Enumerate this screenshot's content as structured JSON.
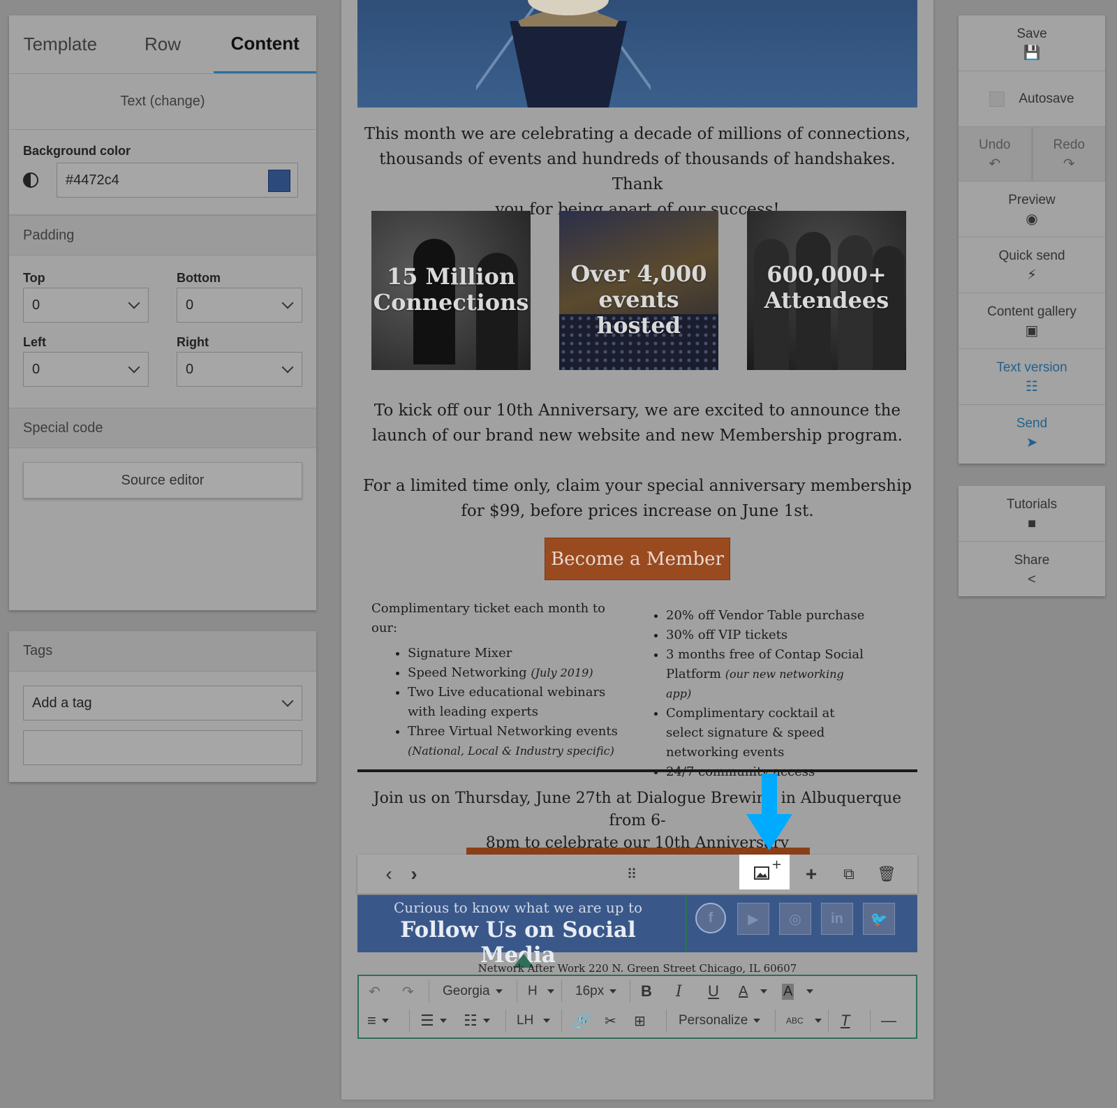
{
  "left_panel": {
    "tabs": [
      "Template",
      "Row",
      "Content"
    ],
    "active_tab": "Content",
    "text_change": "Text (change)",
    "background_color_label": "Background color",
    "background_color_value": "#4472c4",
    "padding_label": "Padding",
    "padding": {
      "top_label": "Top",
      "top_value": "0",
      "bottom_label": "Bottom",
      "bottom_value": "0",
      "left_label": "Left",
      "left_value": "0",
      "right_label": "Right",
      "right_value": "0"
    },
    "special_code_label": "Special code",
    "source_editor_label": "Source editor"
  },
  "tags_panel": {
    "title": "Tags",
    "add_tag_placeholder": "Add a tag",
    "tag_input_value": ""
  },
  "email": {
    "intro_lines": [
      "This month we are celebrating a decade of millions of connections,",
      "thousands of events and hundreds of thousands of handshakes. Thank",
      "you for being apart of our success!"
    ],
    "photos": [
      {
        "caption_lines": [
          "15 Million",
          "Connections"
        ]
      },
      {
        "caption_lines": [
          "Over 4,000",
          "events hosted"
        ]
      },
      {
        "caption_lines": [
          "600,000+",
          "Attendees"
        ]
      }
    ],
    "anniv_lines": [
      "To kick off our 10th Anniversary, we are excited to announce the",
      "launch of our brand new website and new Membership program."
    ],
    "offer_lines": [
      "For a limited time only, claim your special anniversary membership",
      "for $99, before prices increase on June 1st."
    ],
    "member_button": "Become a Member",
    "left_list_intro": "Complimentary ticket each month to our:",
    "left_list": [
      {
        "text": "Signature Mixer",
        "note": ""
      },
      {
        "text": "Speed Networking ",
        "note": "(July 2019)"
      },
      {
        "text": "Two Live educational webinars with leading experts",
        "note": ""
      },
      {
        "text": "Three Virtual Networking events ",
        "note": "(National, Local & Industry specific)"
      }
    ],
    "right_list": [
      {
        "text": "20% off Vendor Table purchase",
        "note": ""
      },
      {
        "text": "30% off VIP tickets",
        "note": ""
      },
      {
        "text": "3 months free of Contap Social Platform ",
        "note": "(our new networking app)"
      },
      {
        "text": "Complimentary cocktail at select signature & speed networking events",
        "note": ""
      },
      {
        "text": "24/7 community access",
        "note": ""
      }
    ],
    "join_lines": [
      "Join us on Thursday, June 27th at Dialogue Brewing in Albuquerque from 6-",
      "8pm to celebrate our 10th Anniversary"
    ],
    "social_small": "Curious to know what we are up to",
    "social_big": "Follow Us on Social Media",
    "social_icons": [
      "f",
      "▶",
      "◎",
      "in",
      "🐦"
    ],
    "footer_address": "Network After Work 220 N. Green Street Chicago, IL 60607",
    "toolbar": {
      "font": "Georgia",
      "heading": "H",
      "size": "16px",
      "bold": "B",
      "italic": "I",
      "underline": "U",
      "font_color": "A",
      "bg_color": "A",
      "line_height": "LH",
      "personalize": "Personalize",
      "spell": "ABC"
    }
  },
  "right_panel": {
    "save": "Save",
    "autosave": "Autosave",
    "undo": "Undo",
    "redo": "Redo",
    "preview": "Preview",
    "quick_send": "Quick send",
    "content_gallery": "Content gallery",
    "text_version": "Text version",
    "send": "Send",
    "tutorials": "Tutorials",
    "share": "Share"
  },
  "colors": {
    "accent": "#2f6fa0",
    "social_block_bg": "#4472c4",
    "member_button": "#c0602a",
    "highlight_arrow": "#00aaff"
  }
}
